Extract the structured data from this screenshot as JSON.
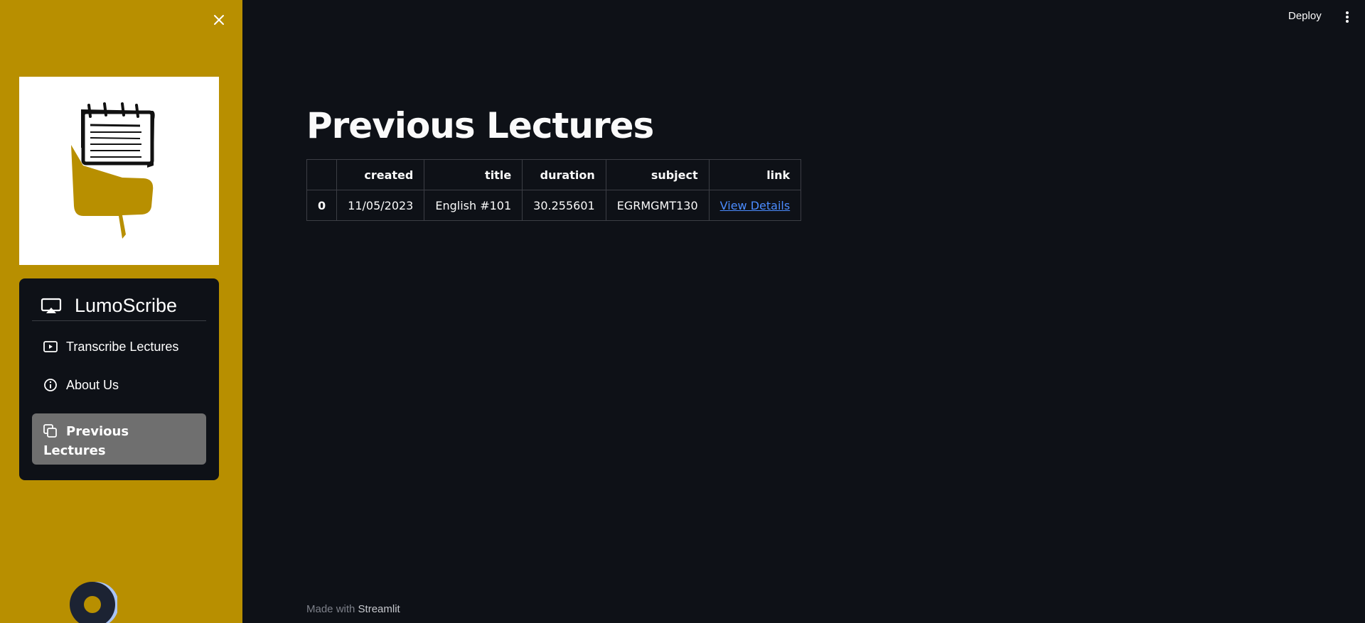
{
  "sidebar": {
    "app_name": "LumoScribe",
    "items": [
      {
        "label": "Transcribe Lectures",
        "icon": "play-box-icon"
      },
      {
        "label": "About Us",
        "icon": "info-icon"
      },
      {
        "label": "Previous Lectures",
        "icon": "copy-icon",
        "active": true
      }
    ],
    "colors": {
      "sidebar_bg": "#b88f00",
      "nav_bg": "#0e1117",
      "active_bg": "#6f6f6f"
    }
  },
  "header": {
    "deploy_label": "Deploy"
  },
  "main": {
    "title": "Previous Lectures",
    "table": {
      "columns": [
        "",
        "created",
        "title",
        "duration",
        "subject",
        "link"
      ],
      "rows": [
        [
          "0",
          "11/05/2023",
          "English #101",
          "30.255601",
          "EGRMGMT130",
          "View Details"
        ]
      ]
    }
  },
  "footer": {
    "prefix": "Made with",
    "brand": "Streamlit"
  },
  "colors": {
    "page_bg": "#0e1117",
    "link": "#4b8cff"
  }
}
